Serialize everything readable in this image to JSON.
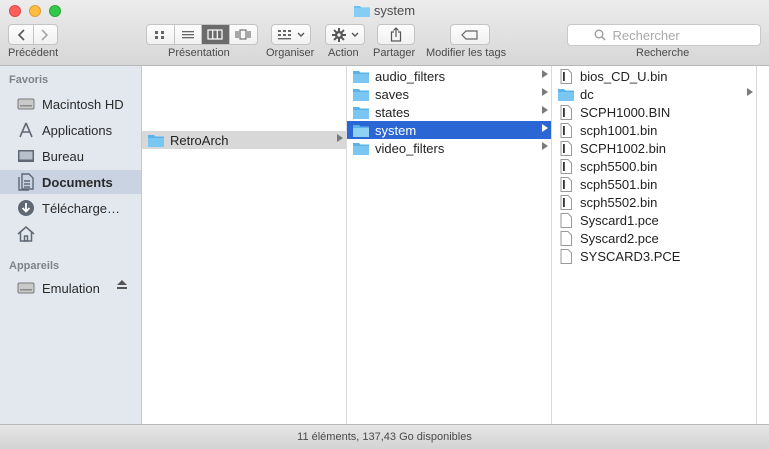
{
  "window": {
    "title": "system"
  },
  "toolbar": {
    "back_label": "Précédent",
    "view_label": "Présentation",
    "arrange_label": "Organiser",
    "action_label": "Action",
    "share_label": "Partager",
    "tags_label": "Modifier les tags",
    "search_label": "Recherche",
    "search_placeholder": "Rechercher",
    "selected_view": "columns"
  },
  "sidebar": {
    "favorites_title": "Favoris",
    "favorites": [
      {
        "label": "Macintosh HD",
        "icon": "hard-drive-icon"
      },
      {
        "label": "Applications",
        "icon": "applications-icon"
      },
      {
        "label": "Bureau",
        "icon": "desktop-icon"
      },
      {
        "label": "Documents",
        "icon": "documents-icon",
        "selected": true
      },
      {
        "label": "Télécharge…",
        "icon": "downloads-icon"
      },
      {
        "label": "",
        "icon": "home-icon"
      }
    ],
    "devices_title": "Appareils",
    "devices": [
      {
        "label": "Emulation",
        "icon": "disk-icon",
        "eject": true
      }
    ]
  },
  "columns": {
    "col1": [
      {
        "name": "RetroArch",
        "type": "folder",
        "has_children": true,
        "state": "path"
      }
    ],
    "col2": [
      {
        "name": "audio_filters",
        "type": "folder",
        "has_children": true
      },
      {
        "name": "saves",
        "type": "folder",
        "has_children": true
      },
      {
        "name": "states",
        "type": "folder",
        "has_children": true
      },
      {
        "name": "system",
        "type": "folder",
        "has_children": true,
        "state": "selected"
      },
      {
        "name": "video_filters",
        "type": "folder",
        "has_children": true
      }
    ],
    "col3": [
      {
        "name": "bios_CD_U.bin",
        "type": "bin"
      },
      {
        "name": "dc",
        "type": "folder",
        "has_children": true
      },
      {
        "name": "SCPH1000.BIN",
        "type": "bin"
      },
      {
        "name": "scph1001.bin",
        "type": "bin"
      },
      {
        "name": "SCPH1002.bin",
        "type": "bin"
      },
      {
        "name": "scph5500.bin",
        "type": "bin"
      },
      {
        "name": "scph5501.bin",
        "type": "bin"
      },
      {
        "name": "scph5502.bin",
        "type": "bin"
      },
      {
        "name": "Syscard1.pce",
        "type": "doc"
      },
      {
        "name": "Syscard2.pce",
        "type": "doc"
      },
      {
        "name": "SYSCARD3.PCE",
        "type": "doc"
      }
    ]
  },
  "status": {
    "text": "11 éléments, 137,43 Go disponibles"
  },
  "colors": {
    "selection": "#2a67d4",
    "folder": "#6cc0f0",
    "sidebar_bg": "#e3e8ef"
  }
}
